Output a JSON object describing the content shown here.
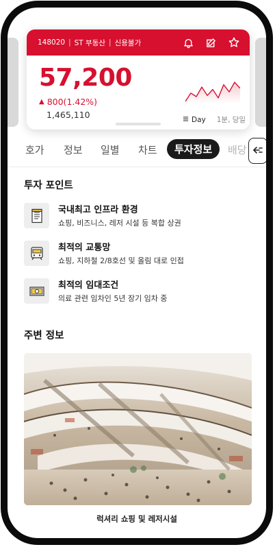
{
  "stock": {
    "code": "148020",
    "name": "ST 부동산",
    "credit": "신용불가",
    "price": "57,200",
    "change": "800(1.42%)",
    "volume": "1,465,110",
    "period_selected": "Day",
    "period_other": "1분, 당일",
    "accent_color": "#d7102f",
    "sparkline": [
      4,
      11,
      8,
      16,
      9,
      14,
      7,
      18,
      12,
      20,
      15
    ]
  },
  "tabs": [
    {
      "label": "호가"
    },
    {
      "label": "정보"
    },
    {
      "label": "일별"
    },
    {
      "label": "차트"
    },
    {
      "label": "투자정보",
      "active": true
    },
    {
      "label": "배당"
    }
  ],
  "invest_points": {
    "title": "투자 포인트",
    "items": [
      {
        "icon": "document-icon",
        "title": "국내최고 인프라 환경",
        "desc": "쇼핑, 비즈니스, 레저 시설 등 복합 상권"
      },
      {
        "icon": "subway-icon",
        "title": "최적의 교통망",
        "desc": "쇼핑, 지하철 2/8호선 및 올림 대로 인접"
      },
      {
        "icon": "money-icon",
        "title": "최적의 임대조건",
        "desc": "의료 관련 임차인 5년 장기 임차 중"
      }
    ]
  },
  "nearby": {
    "title": "주변 정보",
    "caption": "럭셔리 쇼핑 및 레저시설"
  }
}
